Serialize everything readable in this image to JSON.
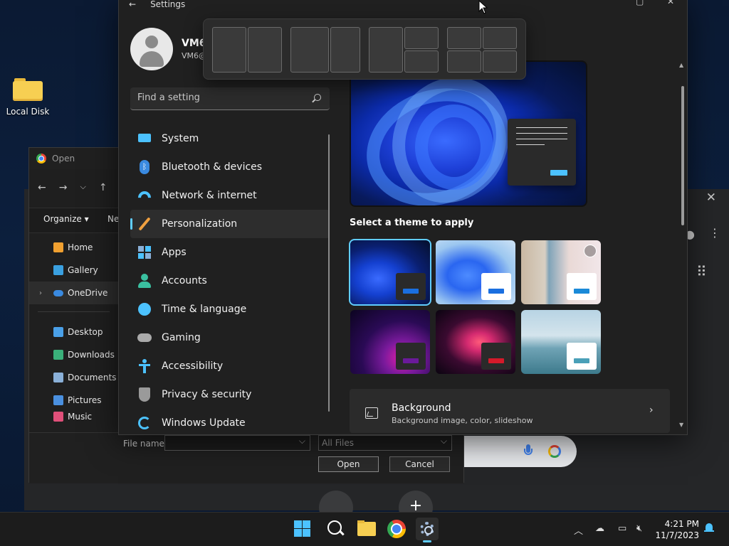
{
  "desktop": {
    "icon_label": "Local Disk"
  },
  "open_dialog": {
    "title": "Open",
    "organize": "Organize ▾",
    "new_trunc": "Ne",
    "nav_tree": [
      {
        "label": "Home",
        "color": "#f0a030"
      },
      {
        "label": "Gallery",
        "color": "#3aa0e0"
      },
      {
        "label": "OneDrive",
        "color": "#3a8ae0"
      },
      {
        "label": "Desktop",
        "color": "#4aa0e8"
      },
      {
        "label": "Downloads",
        "color": "#3ab07a"
      },
      {
        "label": "Documents",
        "color": "#8ab0d8"
      },
      {
        "label": "Pictures",
        "color": "#4a90e0"
      },
      {
        "label": "Music",
        "color": "#e0507a"
      }
    ],
    "file_name_label": "File name:",
    "file_name_value": "",
    "filter": "All Files",
    "open_btn": "Open",
    "cancel_btn": "Cancel"
  },
  "settings": {
    "title": "Settings",
    "user_name": "VM6",
    "user_email": "VM6@",
    "search_placeholder": "Find a setting",
    "nav": [
      {
        "label": "System",
        "icon": "system-icon",
        "color": "#4cc2ff"
      },
      {
        "label": "Bluetooth & devices",
        "icon": "bluetooth-icon",
        "color": "#3a8ae0"
      },
      {
        "label": "Network & internet",
        "icon": "wifi-icon",
        "color": "#4cc2ff"
      },
      {
        "label": "Personalization",
        "icon": "brush-icon",
        "color": "#f0a040"
      },
      {
        "label": "Apps",
        "icon": "apps-icon",
        "color": "#8ab0d8"
      },
      {
        "label": "Accounts",
        "icon": "accounts-icon",
        "color": "#3ac0a0"
      },
      {
        "label": "Time & language",
        "icon": "clock-icon",
        "color": "#4cc2ff"
      },
      {
        "label": "Gaming",
        "icon": "gamepad-icon",
        "color": "#aaaaaa"
      },
      {
        "label": "Accessibility",
        "icon": "accessibility-icon",
        "color": "#4cc2ff"
      },
      {
        "label": "Privacy & security",
        "icon": "shield-icon",
        "color": "#9a9a9a"
      },
      {
        "label": "Windows Update",
        "icon": "update-icon",
        "color": "#4cc2ff"
      }
    ],
    "active_index": 3,
    "themes_title": "Select a theme to apply",
    "themes": [
      {
        "name": "theme-windows-dark",
        "accent": "#1a6fe0"
      },
      {
        "name": "theme-windows-light",
        "accent": "#1a6fe0"
      },
      {
        "name": "theme-spotlight",
        "accent": "#1a8ad8"
      },
      {
        "name": "theme-glow",
        "accent": "#6a1a9a"
      },
      {
        "name": "theme-captured-motion",
        "accent": "#d41a2a"
      },
      {
        "name": "theme-flow",
        "accent": "#4aa0b8"
      }
    ],
    "background": {
      "title": "Background",
      "subtitle": "Background image, color, slideshow"
    }
  },
  "taskbar": {
    "time": "4:21 PM",
    "date": "11/7/2023"
  },
  "colors": {
    "accent": "#60cdff"
  }
}
